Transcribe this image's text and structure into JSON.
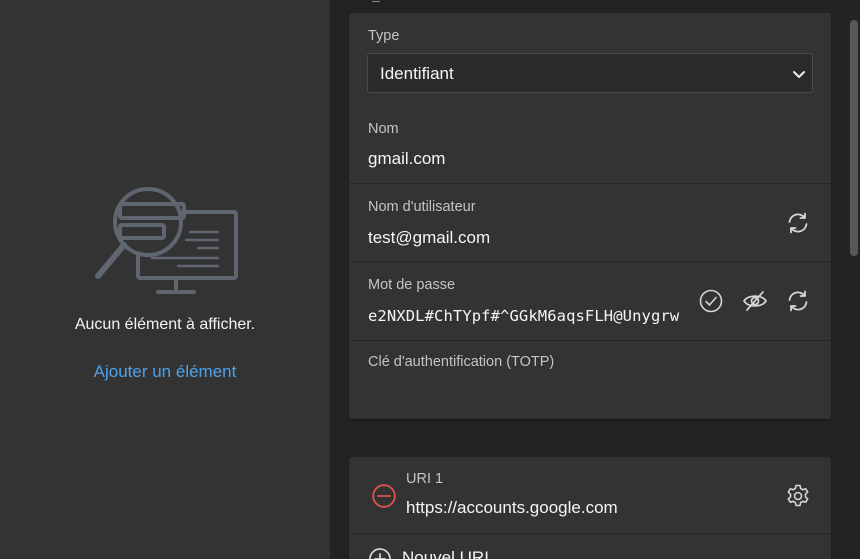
{
  "left_pane": {
    "empty_message": "Aucun élément à afficher.",
    "add_link": "Ajouter un élément"
  },
  "form": {
    "type": {
      "label": "Type",
      "value": "Identifiant"
    },
    "name": {
      "label": "Nom",
      "value": "gmail.com"
    },
    "username": {
      "label": "Nom d'utilisateur",
      "value": "test@gmail.com"
    },
    "password": {
      "label": "Mot de passe",
      "value": "e2NXDL#ChTYpf#^GGkM6aqsFLH@Unygrw"
    },
    "totp": {
      "label": "Clé d'authentification (TOTP)",
      "value": ""
    }
  },
  "uris": {
    "items": [
      {
        "label": "URI 1",
        "value": "https://accounts.google.com"
      }
    ],
    "new_uri_label": "Nouvel URI"
  },
  "icons": {
    "empty_state": "search-screen-illustration",
    "select_caret": "chevron-down-icon",
    "generate_username": "refresh-icon",
    "check_password": "check-circle-icon",
    "toggle_visibility": "eye-slash-icon",
    "generate_password": "refresh-icon",
    "remove_uri": "minus-circle-icon",
    "uri_settings": "gear-icon",
    "add_uri": "plus-circle-icon"
  },
  "colors": {
    "link": "#4ea3e8",
    "danger": "#e0524b",
    "card": "#333333",
    "background": "#232323"
  }
}
